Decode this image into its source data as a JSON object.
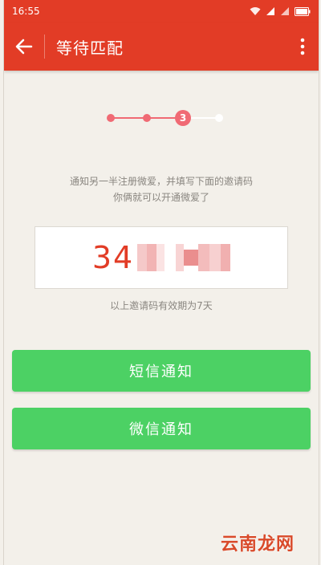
{
  "status_bar": {
    "time": "16:55"
  },
  "app_bar": {
    "title": "等待匹配"
  },
  "stepper": {
    "current_step": "3",
    "total_steps": 4
  },
  "info": {
    "line1": "通知另一半注册微爱，并填写下面的邀请码",
    "line2": "你俩就可以开通微爱了"
  },
  "invite": {
    "code_visible": "34"
  },
  "validity": {
    "text": "以上邀请码有效期为7天"
  },
  "buttons": {
    "sms": "短信通知",
    "wechat": "微信通知"
  },
  "watermark": {
    "text": "云南龙网"
  },
  "colors": {
    "brand": "#e23c26",
    "accent": "#f06a74",
    "button": "#4cd164"
  }
}
